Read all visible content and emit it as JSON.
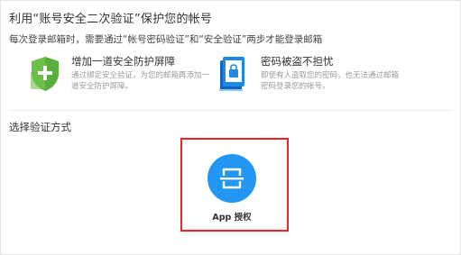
{
  "header": {
    "title": "利用“账号安全二次验证”保护您的帐号",
    "subtitle": "每次登录邮箱时，需要通过“帐号密码验证”和“安全验证”两步才能登录邮箱"
  },
  "features": [
    {
      "title": "增加一道安全防护屏障",
      "desc_lines": [
        "通过绑定安全验证，为您的邮箱再添加一",
        "道安全防护屏障。"
      ],
      "icon": "shield-plus-icon"
    },
    {
      "title": "密码被盗不担忧",
      "desc_lines": [
        "即使有人盗取您的密码，也无法通过邮箱",
        "密码登录您的帐号。"
      ],
      "icon": "phone-lock-icon"
    }
  ],
  "verification": {
    "section_label": "选择验证方式",
    "options": [
      {
        "label": "App 授权",
        "icon": "scan-icon",
        "selected": true
      }
    ]
  },
  "colors": {
    "accent_blue": "#2196f3",
    "selection_red": "#e8262a",
    "shield_green": "#5cb85c"
  }
}
